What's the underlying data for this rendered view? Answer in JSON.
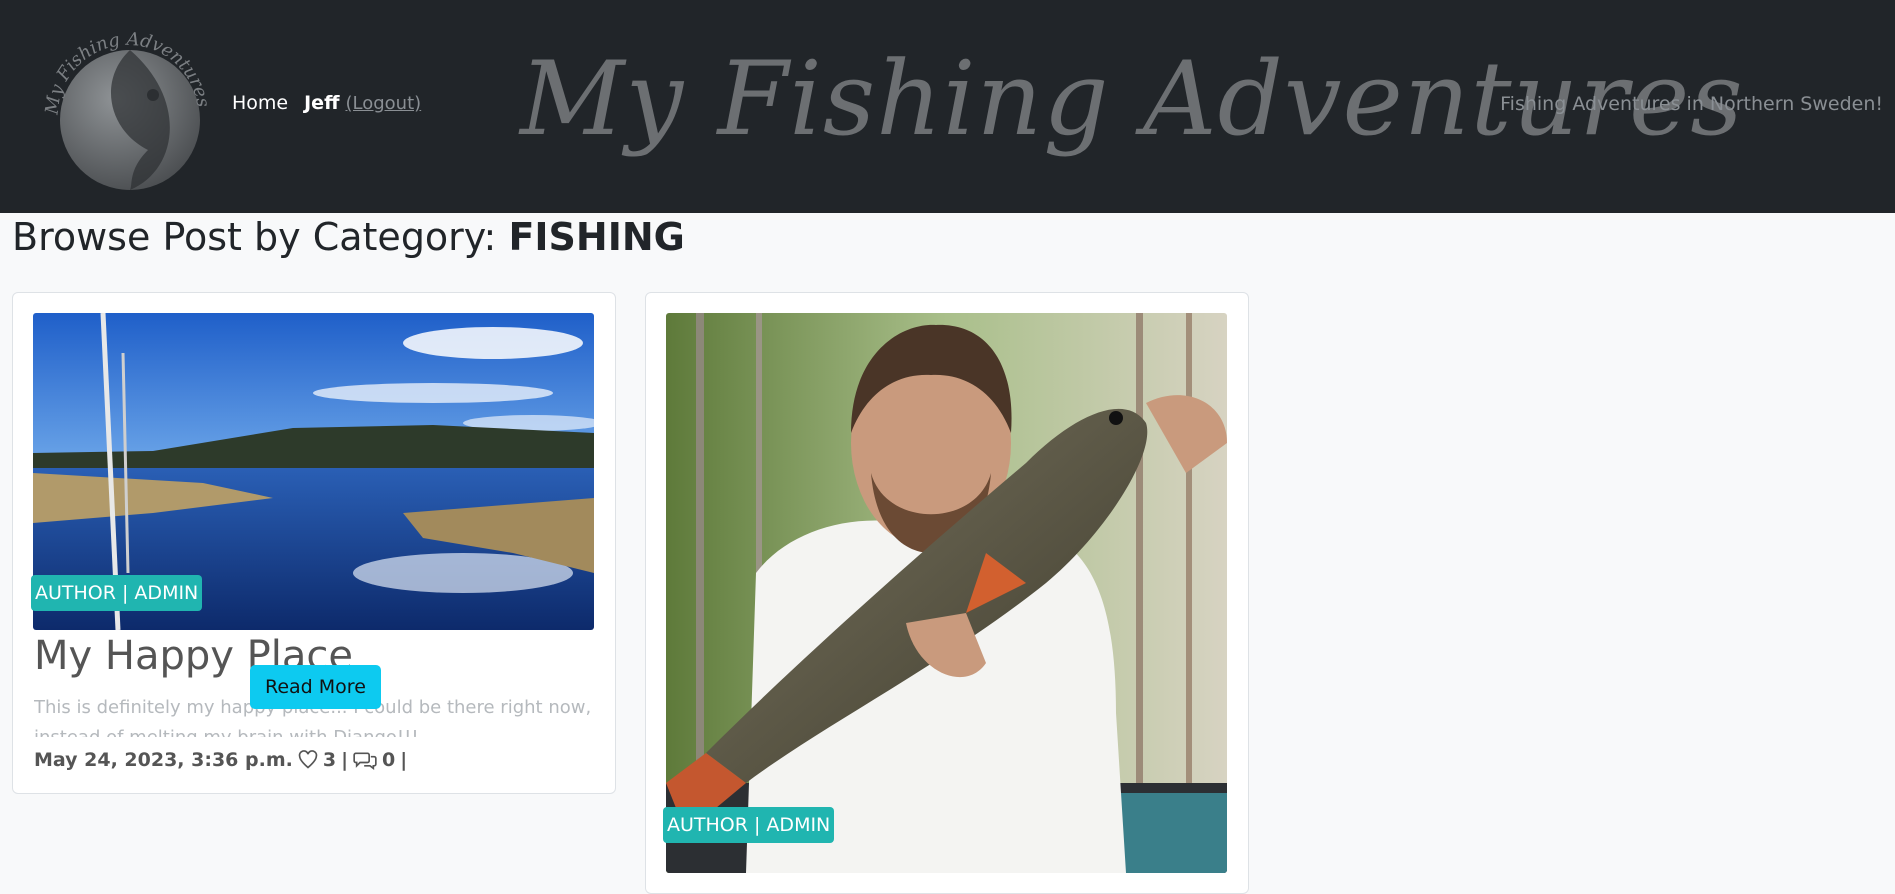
{
  "header": {
    "logo_text": "My Fishing Adventures",
    "nav": {
      "home": "Home",
      "user": "Jeff",
      "logout": "(Logout)"
    },
    "brand": "My Fishing Adventures",
    "tagline": "Fishing Adventures in Northern Sweden!"
  },
  "page": {
    "title_prefix": "Browse Post by Category:",
    "category": "FISHING"
  },
  "posts": [
    {
      "badge": "AUTHOR | ADMIN",
      "title": "My Happy Place",
      "excerpt": "This is definitely my happy place... I could be there right now, instead of melting my brain with Django!!!",
      "read_more": "Read More",
      "date": "May 24, 2023, 3:36 p.m.",
      "likes": "3",
      "comments": "0",
      "sep1": "|",
      "sep2": "|"
    },
    {
      "badge": "AUTHOR | ADMIN"
    }
  ],
  "colors": {
    "header_bg": "#212529",
    "badge_bg": "#20b5b0",
    "button_bg": "#0dcaf0"
  }
}
